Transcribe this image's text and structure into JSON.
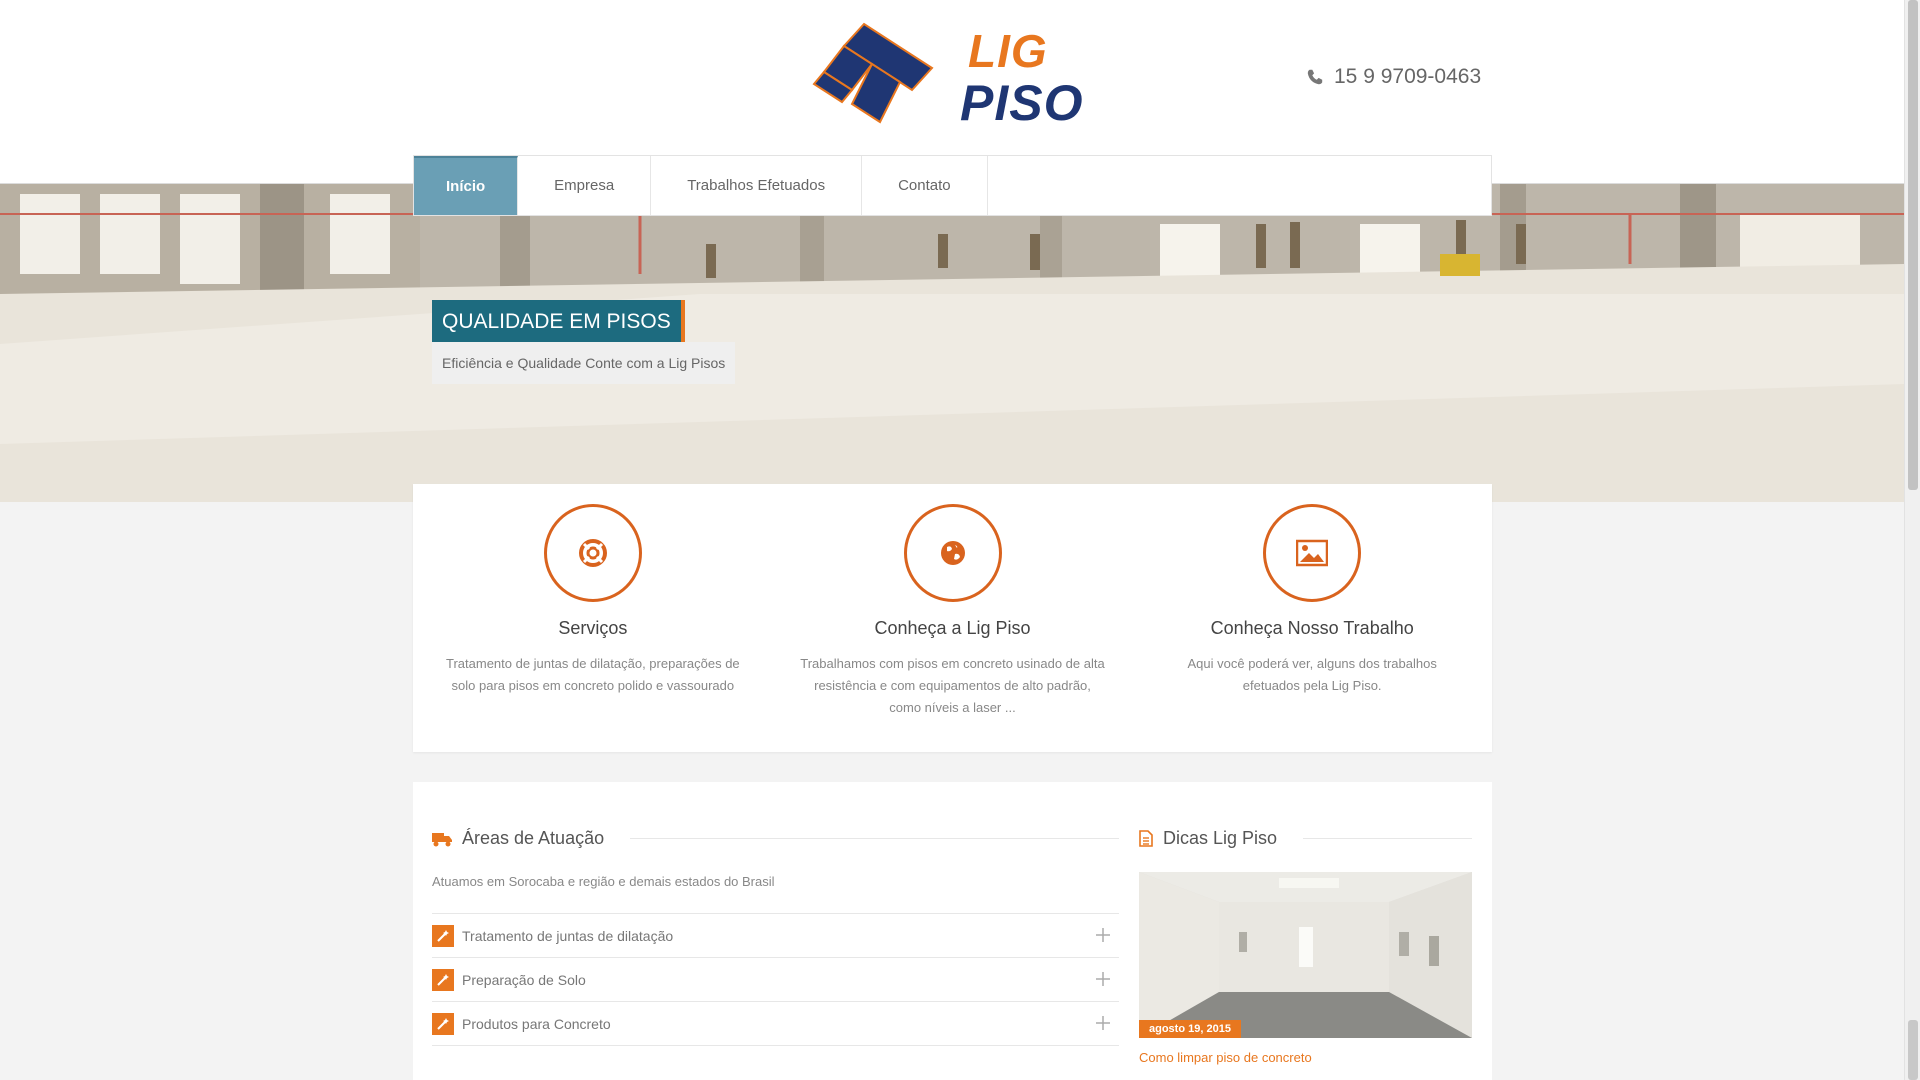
{
  "brand": {
    "logo_line1": "LIG",
    "logo_line2": "PISO",
    "orange": "#e8771f",
    "navy": "#1f3673",
    "teal": "#1d6b7f"
  },
  "header": {
    "phone_icon": "phone-icon",
    "phone": "15 9 9709-0463"
  },
  "nav": {
    "items": [
      {
        "label": "Início",
        "active": true
      },
      {
        "label": "Empresa",
        "active": false
      },
      {
        "label": "Trabalhos Efetuados",
        "active": false
      },
      {
        "label": "Contato",
        "active": false
      }
    ]
  },
  "hero": {
    "title": "QUALIDADE EM PISOS",
    "subtitle": "Eficiência e Qualidade Conte com a Lig Pisos"
  },
  "features": [
    {
      "icon": "lifebuoy-icon",
      "title": "Serviços",
      "text": "Tratamento de juntas  de dilatação, preparações de solo para pisos em concreto polido e vassourado"
    },
    {
      "icon": "globe-icon",
      "title": "Conheça a Lig Piso",
      "text": "Trabalhamos com pisos em concreto usinado de alta resistência e com equipamentos de alto padrão, como níveis a laser ..."
    },
    {
      "icon": "image-icon",
      "title": "Conheça Nosso Trabalho",
      "text": "Aqui você poderá ver, alguns dos trabalhos efetuados pela Lig Piso."
    }
  ],
  "areas": {
    "icon": "truck-icon",
    "title": "Áreas de Atuação",
    "description": "Atuamos em Sorocaba e região e demais estados do Brasil",
    "items": [
      {
        "label": "Tratamento de juntas de dilatação"
      },
      {
        "label": "Preparação de Solo"
      },
      {
        "label": "Produtos para Concreto"
      }
    ]
  },
  "blog": {
    "icon": "document-icon",
    "title": "Dicas Lig Piso",
    "date": "agosto 19, 2015",
    "post_title": "Como limpar piso de concreto"
  }
}
